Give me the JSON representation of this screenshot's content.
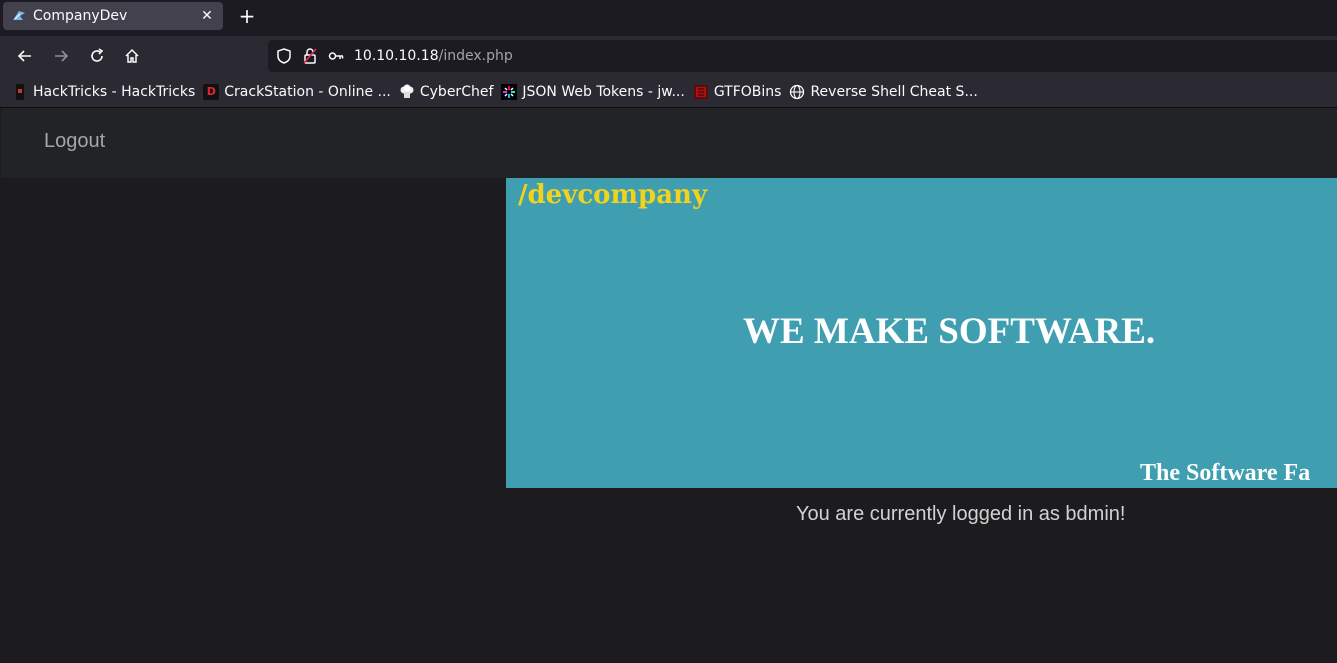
{
  "browser": {
    "tab": {
      "title": "CompanyDev",
      "favicon": "custom-favicon-icon",
      "close_symbol": "✕"
    },
    "new_tab_symbol": "+",
    "url": {
      "host": "10.10.10.18",
      "path": "/index.php"
    },
    "bookmarks": [
      {
        "label": "HackTricks - HackTricks",
        "icon": "hacktricks-icon"
      },
      {
        "label": "CrackStation - Online ...",
        "icon": "crackstation-icon"
      },
      {
        "label": "CyberChef",
        "icon": "cyberchef-icon"
      },
      {
        "label": "JSON Web Tokens - jw...",
        "icon": "jwt-icon"
      },
      {
        "label": "GTFOBins",
        "icon": "gtfobins-icon"
      },
      {
        "label": "Reverse Shell Cheat S...",
        "icon": "globe-icon"
      }
    ]
  },
  "site": {
    "nav": {
      "logout_label": "Logout"
    },
    "banner": {
      "brand": "/devcompany",
      "headline": "WE MAKE SOFTWARE.",
      "tagline": "The Software Fa"
    },
    "status_text": "You are currently logged in as bdmin!"
  },
  "colors": {
    "banner_bg": "#3f9fb0",
    "brand_yellow": "#f2d31c",
    "page_bg": "#1c1b1e"
  }
}
